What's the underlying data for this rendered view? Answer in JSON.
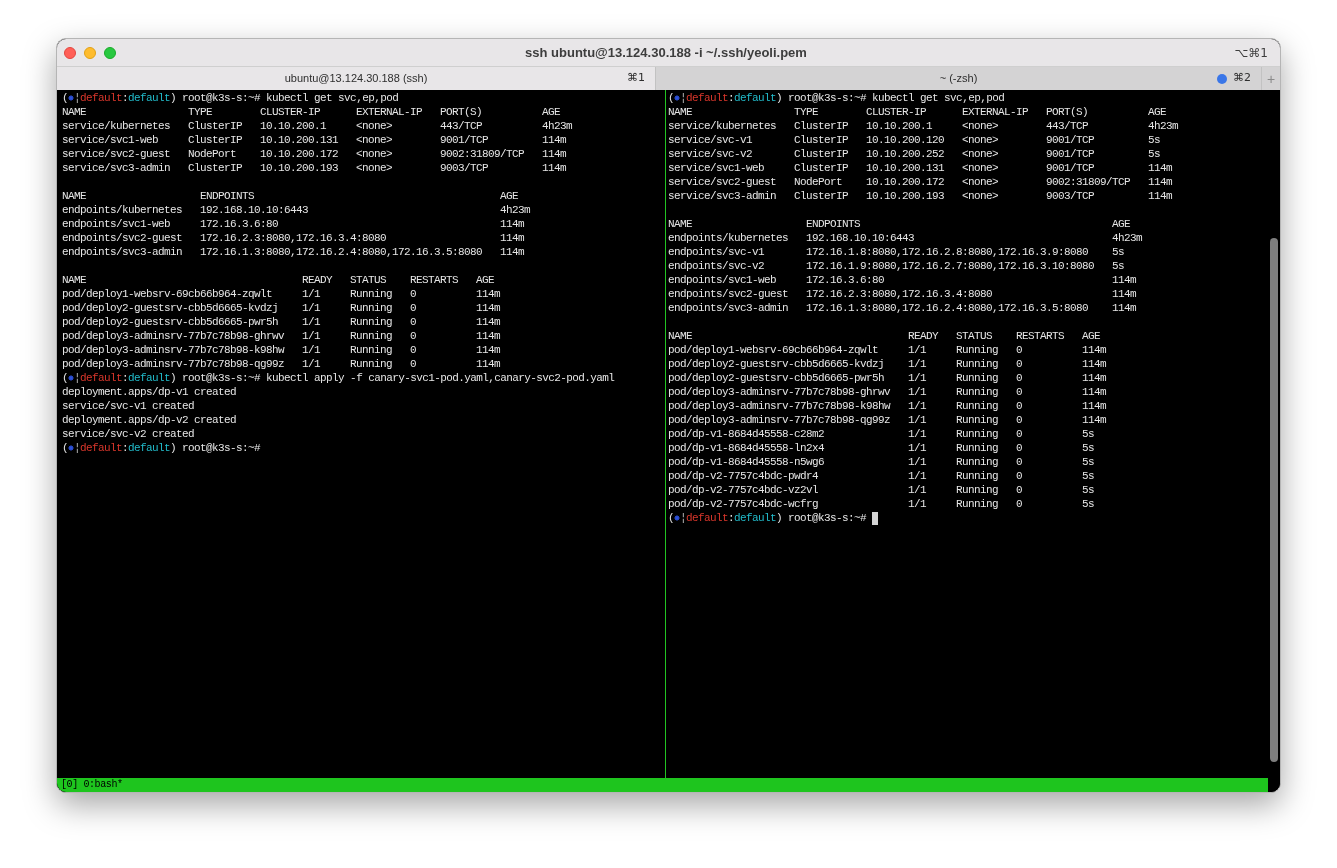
{
  "window": {
    "title": "ssh ubuntu@13.124.30.188 -i ~/.ssh/yeoli.pem",
    "shortcut": "⌥⌘1"
  },
  "tabs": [
    {
      "label": "ubuntu@13.124.30.188 (ssh)",
      "shortcut": "⌘1",
      "selected": true,
      "activity": false
    },
    {
      "label": "~ (-zsh)",
      "shortcut": "⌘2",
      "selected": false,
      "activity": true
    }
  ],
  "new_tab": "+",
  "panes": [
    {
      "lines": [
        {
          "kind": "prompt",
          "open": "(",
          "separator": "¦",
          "cluster": "default",
          "delimiter": ":",
          "namespace": "default",
          "close": ")",
          "host": "root@k3s-s:~#",
          "command": "kubectl get svc,ep,pod"
        },
        {
          "kind": "table",
          "columns": [
            "NAME",
            "TYPE",
            "CLUSTER-IP",
            "EXTERNAL-IP",
            "PORT(S)",
            "AGE"
          ],
          "rows": [
            [
              "service/kubernetes",
              "ClusterIP",
              "10.10.200.1",
              "<none>",
              "443/TCP",
              "4h23m"
            ],
            [
              "service/svc1-web",
              "ClusterIP",
              "10.10.200.131",
              "<none>",
              "9001/TCP",
              "114m"
            ],
            [
              "service/svc2-guest",
              "NodePort",
              "10.10.200.172",
              "<none>",
              "9002:31809/TCP",
              "114m"
            ],
            [
              "service/svc3-admin",
              "ClusterIP",
              "10.10.200.193",
              "<none>",
              "9003/TCP",
              "114m"
            ]
          ]
        },
        {
          "kind": "table",
          "columns": [
            "NAME",
            "ENDPOINTS",
            "AGE"
          ],
          "rows": [
            [
              "endpoints/kubernetes",
              "192.168.10.10:6443",
              "4h23m"
            ],
            [
              "endpoints/svc1-web",
              "172.16.3.6:80",
              "114m"
            ],
            [
              "endpoints/svc2-guest",
              "172.16.2.3:8080,172.16.3.4:8080",
              "114m"
            ],
            [
              "endpoints/svc3-admin",
              "172.16.1.3:8080,172.16.2.4:8080,172.16.3.5:8080",
              "114m"
            ]
          ]
        },
        {
          "kind": "table",
          "columns": [
            "NAME",
            "READY",
            "STATUS",
            "RESTARTS",
            "AGE"
          ],
          "rows": [
            [
              "pod/deploy1-websrv-69cb66b964-zqwlt",
              "1/1",
              "Running",
              "0",
              "114m"
            ],
            [
              "pod/deploy2-guestsrv-cbb5d6665-kvdzj",
              "1/1",
              "Running",
              "0",
              "114m"
            ],
            [
              "pod/deploy2-guestsrv-cbb5d6665-pwr5h",
              "1/1",
              "Running",
              "0",
              "114m"
            ],
            [
              "pod/deploy3-adminsrv-77b7c78b98-ghrwv",
              "1/1",
              "Running",
              "0",
              "114m"
            ],
            [
              "pod/deploy3-adminsrv-77b7c78b98-k98hw",
              "1/1",
              "Running",
              "0",
              "114m"
            ],
            [
              "pod/deploy3-adminsrv-77b7c78b98-qg99z",
              "1/1",
              "Running",
              "0",
              "114m"
            ]
          ]
        },
        {
          "kind": "prompt",
          "open": "(",
          "separator": "¦",
          "cluster": "default",
          "delimiter": ":",
          "namespace": "default",
          "close": ")",
          "host": "root@k3s-s:~#",
          "command": "kubectl apply -f canary-svc1-pod.yaml,canary-svc2-pod.yaml"
        },
        {
          "kind": "output",
          "text": "deployment.apps/dp-v1 created"
        },
        {
          "kind": "output",
          "text": "service/svc-v1 created"
        },
        {
          "kind": "output",
          "text": "deployment.apps/dp-v2 created"
        },
        {
          "kind": "output",
          "text": "service/svc-v2 created"
        },
        {
          "kind": "prompt",
          "open": "(",
          "separator": "¦",
          "cluster": "default",
          "delimiter": ":",
          "namespace": "default",
          "close": ")",
          "host": "root@k3s-s:~#"
        }
      ]
    },
    {
      "lines": [
        {
          "kind": "prompt",
          "open": "(",
          "separator": "¦",
          "cluster": "default",
          "delimiter": ":",
          "namespace": "default",
          "close": ")",
          "host": "root@k3s-s:~#",
          "command": "kubectl get svc,ep,pod"
        },
        {
          "kind": "table",
          "columns": [
            "NAME",
            "TYPE",
            "CLUSTER-IP",
            "EXTERNAL-IP",
            "PORT(S)",
            "AGE"
          ],
          "rows": [
            [
              "service/kubernetes",
              "ClusterIP",
              "10.10.200.1",
              "<none>",
              "443/TCP",
              "4h23m"
            ],
            [
              "service/svc-v1",
              "ClusterIP",
              "10.10.200.120",
              "<none>",
              "9001/TCP",
              "5s"
            ],
            [
              "service/svc-v2",
              "ClusterIP",
              "10.10.200.252",
              "<none>",
              "9001/TCP",
              "5s"
            ],
            [
              "service/svc1-web",
              "ClusterIP",
              "10.10.200.131",
              "<none>",
              "9001/TCP",
              "114m"
            ],
            [
              "service/svc2-guest",
              "NodePort",
              "10.10.200.172",
              "<none>",
              "9002:31809/TCP",
              "114m"
            ],
            [
              "service/svc3-admin",
              "ClusterIP",
              "10.10.200.193",
              "<none>",
              "9003/TCP",
              "114m"
            ]
          ]
        },
        {
          "kind": "table",
          "columns": [
            "NAME",
            "ENDPOINTS",
            "AGE"
          ],
          "rows": [
            [
              "endpoints/kubernetes",
              "192.168.10.10:6443",
              "4h23m"
            ],
            [
              "endpoints/svc-v1",
              "172.16.1.8:8080,172.16.2.8:8080,172.16.3.9:8080",
              "5s"
            ],
            [
              "endpoints/svc-v2",
              "172.16.1.9:8080,172.16.2.7:8080,172.16.3.10:8080",
              "5s"
            ],
            [
              "endpoints/svc1-web",
              "172.16.3.6:80",
              "114m"
            ],
            [
              "endpoints/svc2-guest",
              "172.16.2.3:8080,172.16.3.4:8080",
              "114m"
            ],
            [
              "endpoints/svc3-admin",
              "172.16.1.3:8080,172.16.2.4:8080,172.16.3.5:8080",
              "114m"
            ]
          ]
        },
        {
          "kind": "table",
          "columns": [
            "NAME",
            "READY",
            "STATUS",
            "RESTARTS",
            "AGE"
          ],
          "rows": [
            [
              "pod/deploy1-websrv-69cb66b964-zqwlt",
              "1/1",
              "Running",
              "0",
              "114m"
            ],
            [
              "pod/deploy2-guestsrv-cbb5d6665-kvdzj",
              "1/1",
              "Running",
              "0",
              "114m"
            ],
            [
              "pod/deploy2-guestsrv-cbb5d6665-pwr5h",
              "1/1",
              "Running",
              "0",
              "114m"
            ],
            [
              "pod/deploy3-adminsrv-77b7c78b98-ghrwv",
              "1/1",
              "Running",
              "0",
              "114m"
            ],
            [
              "pod/deploy3-adminsrv-77b7c78b98-k98hw",
              "1/1",
              "Running",
              "0",
              "114m"
            ],
            [
              "pod/deploy3-adminsrv-77b7c78b98-qg99z",
              "1/1",
              "Running",
              "0",
              "114m"
            ],
            [
              "pod/dp-v1-8684d45558-c28m2",
              "1/1",
              "Running",
              "0",
              "5s"
            ],
            [
              "pod/dp-v1-8684d45558-ln2x4",
              "1/1",
              "Running",
              "0",
              "5s"
            ],
            [
              "pod/dp-v1-8684d45558-n5wg6",
              "1/1",
              "Running",
              "0",
              "5s"
            ],
            [
              "pod/dp-v2-7757c4bdc-pwdr4",
              "1/1",
              "Running",
              "0",
              "5s"
            ],
            [
              "pod/dp-v2-7757c4bdc-vz2vl",
              "1/1",
              "Running",
              "0",
              "5s"
            ],
            [
              "pod/dp-v2-7757c4bdc-wcfrg",
              "1/1",
              "Running",
              "0",
              "5s"
            ]
          ]
        },
        {
          "kind": "prompt",
          "open": "(",
          "separator": "¦",
          "cluster": "default",
          "delimiter": ":",
          "namespace": "default",
          "close": ")",
          "host": "root@k3s-s:~#",
          "cursor": true
        }
      ]
    }
  ],
  "status_bar": {
    "left": "[0] 0:bash*"
  }
}
